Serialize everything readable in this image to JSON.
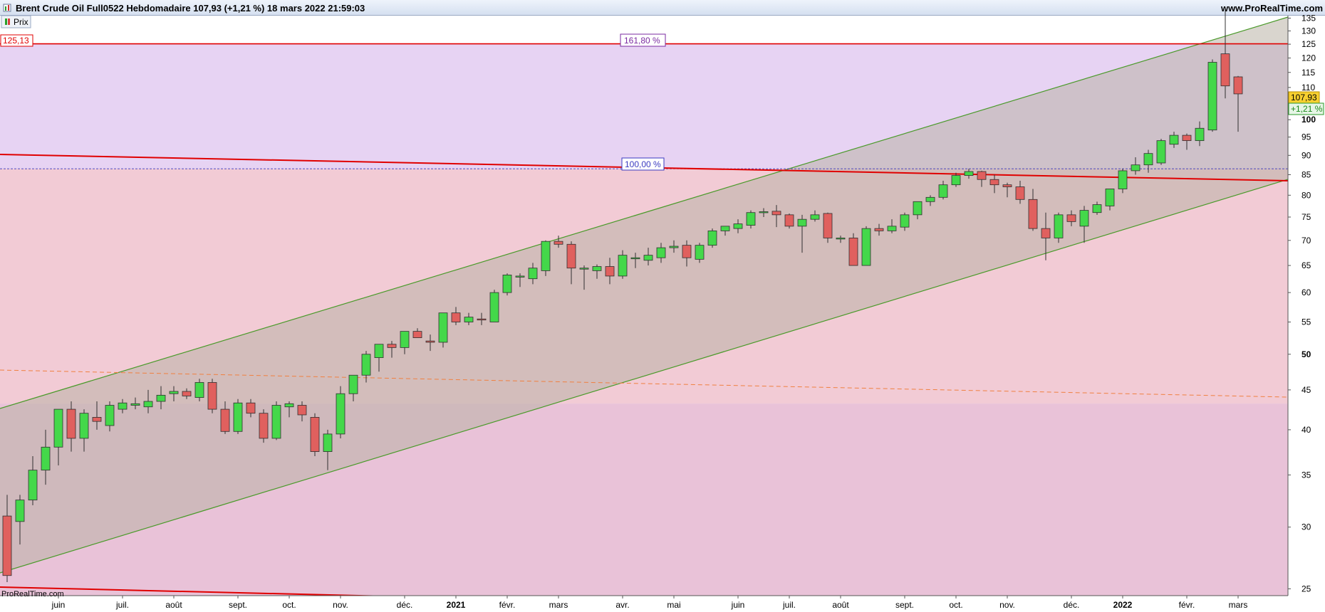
{
  "window": {
    "title": "Brent Crude Oil Full0522 Hebdomadaire 107,93 (+1,21 %) 18 mars 2022 21:59:03",
    "site": "www.ProRealTime.com",
    "legend_label": "Prix",
    "watermark": "ProRealTime.com"
  },
  "colors": {
    "up": "#44d84a",
    "down": "#e0605e",
    "fib_top_zone": "#e7d3f3",
    "fib_mid_zone": "#f2cbd5",
    "fib_low_zone": "#e9c2d8",
    "channel_fill": "#b9b3a6",
    "channel_line": "#4a9a2a",
    "red_line": "#e00000",
    "price_badge": "#f7d030"
  },
  "chart_data": {
    "type": "candlestick",
    "scale": "log",
    "ylim": [
      24.5,
      136
    ],
    "y_ticks": [
      25,
      30,
      35,
      40,
      45,
      50,
      55,
      60,
      65,
      70,
      75,
      80,
      85,
      90,
      95,
      100,
      105,
      110,
      115,
      120,
      125,
      130,
      135
    ],
    "y_bold_ticks": [
      50,
      100
    ],
    "x_labels": [
      {
        "i": 4,
        "label": "juin"
      },
      {
        "i": 9,
        "label": "juil."
      },
      {
        "i": 13,
        "label": "août"
      },
      {
        "i": 18,
        "label": "sept."
      },
      {
        "i": 22,
        "label": "oct."
      },
      {
        "i": 26,
        "label": "nov."
      },
      {
        "i": 31,
        "label": "déc."
      },
      {
        "i": 35,
        "label": "2021"
      },
      {
        "i": 39,
        "label": "févr."
      },
      {
        "i": 43,
        "label": "mars"
      },
      {
        "i": 48,
        "label": "avr."
      },
      {
        "i": 52,
        "label": "mai"
      },
      {
        "i": 57,
        "label": "juin"
      },
      {
        "i": 61,
        "label": "juil."
      },
      {
        "i": 65,
        "label": "août"
      },
      {
        "i": 70,
        "label": "sept."
      },
      {
        "i": 74,
        "label": "oct."
      },
      {
        "i": 78,
        "label": "nov."
      },
      {
        "i": 83,
        "label": "déc."
      },
      {
        "i": 87,
        "label": "2022"
      },
      {
        "i": 92,
        "label": "févr."
      },
      {
        "i": 96,
        "label": "mars"
      }
    ],
    "x_bold_labels": [
      "2021",
      "2022"
    ],
    "candles": [
      [
        31.0,
        33.0,
        25.5,
        26.0
      ],
      [
        30.5,
        33.0,
        28.5,
        32.5
      ],
      [
        32.5,
        37.0,
        32.0,
        35.5
      ],
      [
        35.5,
        40.0,
        34.0,
        38.0
      ],
      [
        38.0,
        42.5,
        36.0,
        42.5
      ],
      [
        42.5,
        43.5,
        37.5,
        39.0
      ],
      [
        39.0,
        42.5,
        37.5,
        42.0
      ],
      [
        41.5,
        43.5,
        40.0,
        41.0
      ],
      [
        40.5,
        43.5,
        39.8,
        43.0
      ],
      [
        42.5,
        43.8,
        42.0,
        43.3
      ],
      [
        43.0,
        44.0,
        42.5,
        43.2
      ],
      [
        42.8,
        45.0,
        42.0,
        43.5
      ],
      [
        43.5,
        45.5,
        42.5,
        44.3
      ],
      [
        44.5,
        45.5,
        43.5,
        44.8
      ],
      [
        44.8,
        45.2,
        43.8,
        44.2
      ],
      [
        44.0,
        46.5,
        43.5,
        46.0
      ],
      [
        46.0,
        46.5,
        42.0,
        42.5
      ],
      [
        42.5,
        43.5,
        39.5,
        39.8
      ],
      [
        39.8,
        43.8,
        39.5,
        43.3
      ],
      [
        43.3,
        43.8,
        41.5,
        42.0
      ],
      [
        42.0,
        42.5,
        38.5,
        39.0
      ],
      [
        39.0,
        43.5,
        38.8,
        43.0
      ],
      [
        42.8,
        43.5,
        41.5,
        43.2
      ],
      [
        43.0,
        43.5,
        41.0,
        41.8
      ],
      [
        41.5,
        42.0,
        37.0,
        37.5
      ],
      [
        37.5,
        40.0,
        35.5,
        39.5
      ],
      [
        39.5,
        45.5,
        39.0,
        44.5
      ],
      [
        44.5,
        47.0,
        43.5,
        47.0
      ],
      [
        47.0,
        50.5,
        46.0,
        50.0
      ],
      [
        49.5,
        51.0,
        47.5,
        51.5
      ],
      [
        51.5,
        52.0,
        49.5,
        51.0
      ],
      [
        51.0,
        53.5,
        50.0,
        53.5
      ],
      [
        53.5,
        54.0,
        52.5,
        52.5
      ],
      [
        52.0,
        53.0,
        50.5,
        51.8
      ],
      [
        51.8,
        56.5,
        51.0,
        56.5
      ],
      [
        56.5,
        57.5,
        54.5,
        55.0
      ],
      [
        55.0,
        56.5,
        54.5,
        55.8
      ],
      [
        55.5,
        56.5,
        54.5,
        55.4
      ],
      [
        55.0,
        60.5,
        55.0,
        60.0
      ],
      [
        60.0,
        63.5,
        59.5,
        63.2
      ],
      [
        62.8,
        63.5,
        61.0,
        63.0
      ],
      [
        62.5,
        65.5,
        61.5,
        64.5
      ],
      [
        64.0,
        70.0,
        63.0,
        69.8
      ],
      [
        69.8,
        71.0,
        68.5,
        69.2
      ],
      [
        69.2,
        69.8,
        61.5,
        64.5
      ],
      [
        64.5,
        65.0,
        60.5,
        64.5
      ],
      [
        64.0,
        65.2,
        62.5,
        64.8
      ],
      [
        64.8,
        66.5,
        61.5,
        63.0
      ],
      [
        63.0,
        68.0,
        62.5,
        67.0
      ],
      [
        66.5,
        67.5,
        64.5,
        66.5
      ],
      [
        66.0,
        68.5,
        65.0,
        67.0
      ],
      [
        66.5,
        69.5,
        65.5,
        68.5
      ],
      [
        68.5,
        70.0,
        67.5,
        68.8
      ],
      [
        69.0,
        70.0,
        64.8,
        66.5
      ],
      [
        66.2,
        69.5,
        65.5,
        69.0
      ],
      [
        69.0,
        72.5,
        68.5,
        72.0
      ],
      [
        72.0,
        73.0,
        71.0,
        73.0
      ],
      [
        72.5,
        74.5,
        71.5,
        73.5
      ],
      [
        73.2,
        76.5,
        72.5,
        76.0
      ],
      [
        76.0,
        77.0,
        75.0,
        76.2
      ],
      [
        76.3,
        77.7,
        72.8,
        75.5
      ],
      [
        75.5,
        75.8,
        72.5,
        73.0
      ],
      [
        73.0,
        75.5,
        67.5,
        74.5
      ],
      [
        74.5,
        76.5,
        74.0,
        75.5
      ],
      [
        75.8,
        76.0,
        69.5,
        70.5
      ],
      [
        70.5,
        71.0,
        69.5,
        70.5
      ],
      [
        70.5,
        71.5,
        65.0,
        65.0
      ],
      [
        65.0,
        73.0,
        65.0,
        72.5
      ],
      [
        72.5,
        73.5,
        71.0,
        72.0
      ],
      [
        72.0,
        74.5,
        71.5,
        73.0
      ],
      [
        72.8,
        76.0,
        72.0,
        75.5
      ],
      [
        75.5,
        78.5,
        74.5,
        78.5
      ],
      [
        78.5,
        80.0,
        77.5,
        79.5
      ],
      [
        79.5,
        83.5,
        79.0,
        82.5
      ],
      [
        82.5,
        85.5,
        82.0,
        84.8
      ],
      [
        84.8,
        86.5,
        84.0,
        85.8
      ],
      [
        85.8,
        86.0,
        82.0,
        83.8
      ],
      [
        83.8,
        85.0,
        80.5,
        82.5
      ],
      [
        82.5,
        83.0,
        79.5,
        82.0
      ],
      [
        82.0,
        83.5,
        78.0,
        79.0
      ],
      [
        79.0,
        81.5,
        72.0,
        72.5
      ],
      [
        72.5,
        76.0,
        66.0,
        70.5
      ],
      [
        70.5,
        76.0,
        69.5,
        75.5
      ],
      [
        75.5,
        76.5,
        73.0,
        74.0
      ],
      [
        73.0,
        77.5,
        69.5,
        76.5
      ],
      [
        76.0,
        78.5,
        75.5,
        77.8
      ],
      [
        77.5,
        81.5,
        76.5,
        81.5
      ],
      [
        81.5,
        86.5,
        80.5,
        86.0
      ],
      [
        86.0,
        89.5,
        85.0,
        87.5
      ],
      [
        87.5,
        91.5,
        85.5,
        90.5
      ],
      [
        88.0,
        94.5,
        87.5,
        94.0
      ],
      [
        93.0,
        96.5,
        92.0,
        95.5
      ],
      [
        95.5,
        96.0,
        91.5,
        94.0
      ],
      [
        94.0,
        99.5,
        92.5,
        97.5
      ],
      [
        97.0,
        119.5,
        96.5,
        118.5
      ],
      [
        121.5,
        139.0,
        106.5,
        110.5
      ],
      [
        113.5,
        113.8,
        96.5,
        107.93
      ]
    ],
    "fibonacci": {
      "top_label": "125,13",
      "levels": [
        {
          "price": 125.13,
          "label": "161,80 %"
        },
        {
          "price": 86.5,
          "label": "100,00 %"
        }
      ]
    },
    "last_price": "107,93",
    "change": "+1,21 %"
  }
}
